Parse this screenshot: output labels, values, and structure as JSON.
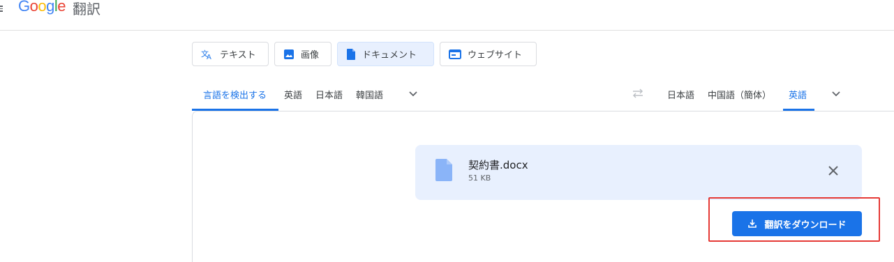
{
  "header": {
    "logo_parts": [
      "G",
      "o",
      "o",
      "g",
      "l",
      "e"
    ],
    "product_name": "翻訳"
  },
  "modes": [
    {
      "label": "テキスト",
      "icon": "translate-icon"
    },
    {
      "label": "画像",
      "icon": "image-icon"
    },
    {
      "label": "ドキュメント",
      "icon": "document-icon",
      "active": true
    },
    {
      "label": "ウェブサイト",
      "icon": "website-icon"
    }
  ],
  "source_languages": [
    "言語を検出する",
    "英語",
    "日本語",
    "韓国語"
  ],
  "target_languages": [
    "日本語",
    "中国語（簡体）",
    "英語"
  ],
  "file": {
    "name": "契約書.docx",
    "size": "51 KB"
  },
  "download_button": {
    "label": "翻訳をダウンロード"
  },
  "colors": {
    "accent": "#1a73e8",
    "card_bg": "#e8f0fe",
    "highlight": "#e53935"
  }
}
